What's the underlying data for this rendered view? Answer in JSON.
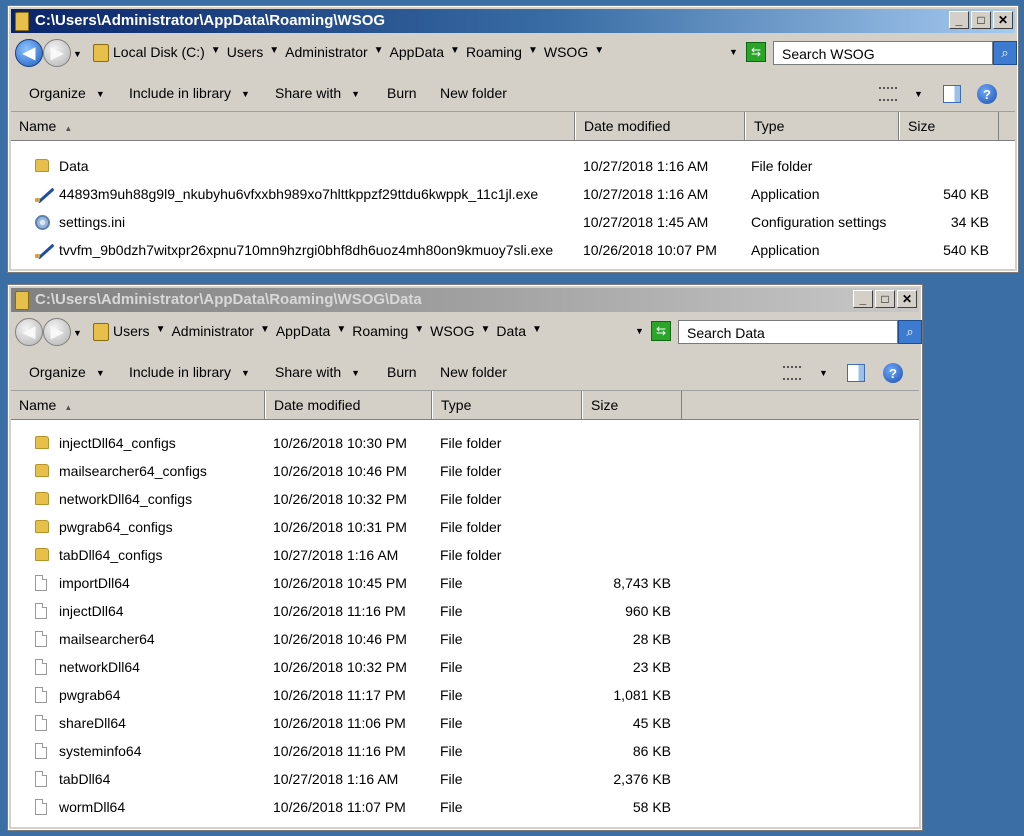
{
  "window1": {
    "title": "C:\\Users\\Administrator\\AppData\\Roaming\\WSOG",
    "breadcrumbs": [
      "Local Disk (C:)",
      "Users",
      "Administrator",
      "AppData",
      "Roaming",
      "WSOG"
    ],
    "search_placeholder": "Search WSOG",
    "toolbar": {
      "organize": "Organize",
      "include": "Include in library",
      "share": "Share with",
      "burn": "Burn",
      "new_folder": "New folder"
    },
    "columns": {
      "name": "Name",
      "date": "Date modified",
      "type": "Type",
      "size": "Size"
    },
    "rows": [
      {
        "name": "Data",
        "date": "10/27/2018 1:16 AM",
        "type": "File folder",
        "size": "",
        "icon": "folder-icon"
      },
      {
        "name": "44893m9uh88g9l9_nkubyhu6vfxxbh989xo7hlttkppzf29ttdu6kwppk_11c1jl.exe",
        "date": "10/27/2018 1:16 AM",
        "type": "Application",
        "size": "540 KB",
        "icon": "application-icon"
      },
      {
        "name": "settings.ini",
        "date": "10/27/2018 1:45 AM",
        "type": "Configuration settings",
        "size": "34 KB",
        "icon": "settings-file-icon"
      },
      {
        "name": "tvvfm_9b0dzh7witxpr26xpnu710mn9hzrgi0bhf8dh6uoz4mh80on9kmuoy7sli.exe",
        "date": "10/26/2018 10:07 PM",
        "type": "Application",
        "size": "540 KB",
        "icon": "application-icon"
      }
    ]
  },
  "window2": {
    "title": "C:\\Users\\Administrator\\AppData\\Roaming\\WSOG\\Data",
    "breadcrumbs": [
      "Users",
      "Administrator",
      "AppData",
      "Roaming",
      "WSOG",
      "Data"
    ],
    "search_placeholder": "Search Data",
    "toolbar": {
      "organize": "Organize",
      "include": "Include in library",
      "share": "Share with",
      "burn": "Burn",
      "new_folder": "New folder"
    },
    "columns": {
      "name": "Name",
      "date": "Date modified",
      "type": "Type",
      "size": "Size"
    },
    "rows": [
      {
        "name": "injectDll64_configs",
        "date": "10/26/2018 10:30 PM",
        "type": "File folder",
        "size": "",
        "icon": "folder-icon"
      },
      {
        "name": "mailsearcher64_configs",
        "date": "10/26/2018 10:46 PM",
        "type": "File folder",
        "size": "",
        "icon": "folder-icon"
      },
      {
        "name": "networkDll64_configs",
        "date": "10/26/2018 10:32 PM",
        "type": "File folder",
        "size": "",
        "icon": "folder-icon"
      },
      {
        "name": "pwgrab64_configs",
        "date": "10/26/2018 10:31 PM",
        "type": "File folder",
        "size": "",
        "icon": "folder-icon"
      },
      {
        "name": "tabDll64_configs",
        "date": "10/27/2018 1:16 AM",
        "type": "File folder",
        "size": "",
        "icon": "folder-icon"
      },
      {
        "name": "importDll64",
        "date": "10/26/2018 10:45 PM",
        "type": "File",
        "size": "8,743 KB",
        "icon": "file-icon"
      },
      {
        "name": "injectDll64",
        "date": "10/26/2018 11:16 PM",
        "type": "File",
        "size": "960 KB",
        "icon": "file-icon"
      },
      {
        "name": "mailsearcher64",
        "date": "10/26/2018 10:46 PM",
        "type": "File",
        "size": "28 KB",
        "icon": "file-icon"
      },
      {
        "name": "networkDll64",
        "date": "10/26/2018 10:32 PM",
        "type": "File",
        "size": "23 KB",
        "icon": "file-icon"
      },
      {
        "name": "pwgrab64",
        "date": "10/26/2018 11:17 PM",
        "type": "File",
        "size": "1,081 KB",
        "icon": "file-icon"
      },
      {
        "name": "shareDll64",
        "date": "10/26/2018 11:06 PM",
        "type": "File",
        "size": "45 KB",
        "icon": "file-icon"
      },
      {
        "name": "systeminfo64",
        "date": "10/26/2018 11:16 PM",
        "type": "File",
        "size": "86 KB",
        "icon": "file-icon"
      },
      {
        "name": "tabDll64",
        "date": "10/27/2018 1:16 AM",
        "type": "File",
        "size": "2,376 KB",
        "icon": "file-icon"
      },
      {
        "name": "wormDll64",
        "date": "10/26/2018 11:07 PM",
        "type": "File",
        "size": "58 KB",
        "icon": "file-icon"
      }
    ]
  },
  "colors": {
    "desktop": "#3a6ea5",
    "active_title": "#0a246a",
    "inactive_title": "#808080"
  }
}
